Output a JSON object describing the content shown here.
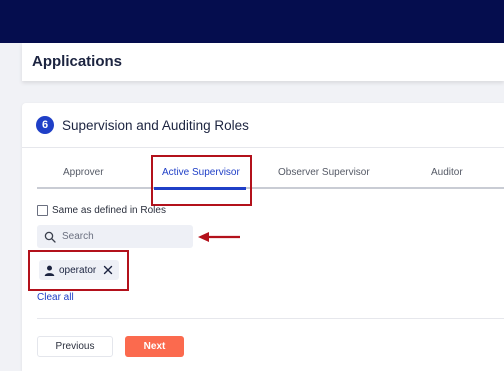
{
  "header": {
    "title": "Applications"
  },
  "section": {
    "step": "6",
    "title": "Supervision and Auditing Roles"
  },
  "tabs": [
    {
      "label": "Approver"
    },
    {
      "label": "Active Supervisor"
    },
    {
      "label": "Observer Supervisor"
    },
    {
      "label": "Auditor"
    }
  ],
  "active_tab": "Active Supervisor",
  "same_as_roles": {
    "label": "Same as defined in Roles",
    "checked": false
  },
  "search": {
    "placeholder": "Search",
    "value": ""
  },
  "selected": [
    {
      "label": "operator",
      "icon": "user-icon"
    }
  ],
  "clear_all": "Clear all",
  "buttons": {
    "previous": "Previous",
    "next": "Next"
  },
  "colors": {
    "accent": "#1f3fc7",
    "primary_button": "#fb6a4e",
    "highlight": "#b3111b",
    "topbar": "#050d4e"
  }
}
